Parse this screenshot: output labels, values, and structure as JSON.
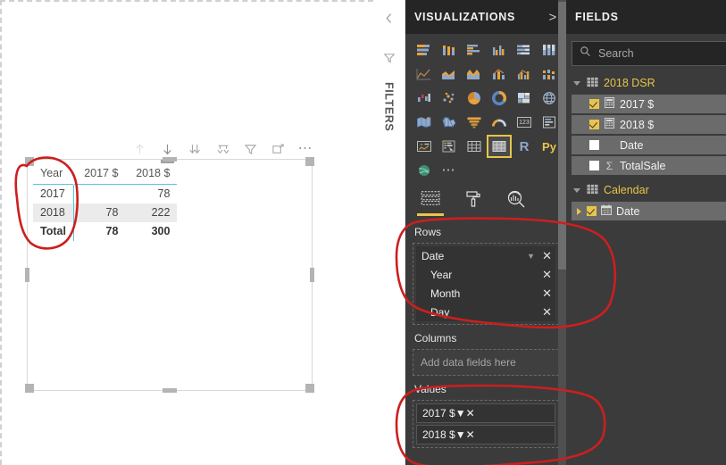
{
  "canvas": {
    "visual_toolbar": [
      {
        "name": "drill-up-icon",
        "label": "Drill Up",
        "state": "disabled"
      },
      {
        "name": "drill-down-icon",
        "label": "Drill Down",
        "state": "active"
      },
      {
        "name": "expand-all-icon",
        "label": "Expand all down one level in the hierarchy",
        "state": "normal"
      },
      {
        "name": "go-to-next-level-icon",
        "label": "Go to the next level in the hierarchy",
        "state": "normal"
      },
      {
        "name": "filter-icon",
        "label": "Filters",
        "state": "normal"
      },
      {
        "name": "focus-mode-icon",
        "label": "Focus mode",
        "state": "normal"
      },
      {
        "name": "more-options-icon",
        "label": "More options",
        "state": "normal"
      }
    ]
  },
  "chart_data": {
    "type": "table",
    "title": "",
    "columns": [
      "Year",
      "2017 $",
      "2018 $"
    ],
    "rows": [
      {
        "label": "2017",
        "values": [
          "",
          "78"
        ],
        "banded": false,
        "total": false
      },
      {
        "label": "2018",
        "values": [
          "78",
          "222"
        ],
        "banded": true,
        "total": false
      },
      {
        "label": "Total",
        "values": [
          "78",
          "300"
        ],
        "banded": false,
        "total": true
      }
    ],
    "categories": [
      "2017",
      "2018",
      "Total"
    ],
    "series": [
      {
        "name": "2017 $",
        "values": [
          null,
          78,
          78
        ]
      },
      {
        "name": "2018 $",
        "values": [
          78,
          222,
          300
        ]
      }
    ],
    "xlabel": "Year",
    "ylabel": "",
    "grid": false,
    "legend": "none",
    "accent_color": "#59c6d6",
    "band_color": "#ebebeb"
  },
  "filters_rail": {
    "collapse_label": "collapse-chevron",
    "filter_icon": "filter-icon",
    "label": "FILTERS"
  },
  "visualizations": {
    "header": "VISUALIZATIONS",
    "header_chevron": ">",
    "selected_visual": "matrix",
    "gallery": [
      {
        "name": "stacked-bar-chart-icon",
        "label": "Stacked bar chart"
      },
      {
        "name": "stacked-column-chart-icon",
        "label": "Stacked column chart"
      },
      {
        "name": "clustered-bar-chart-icon",
        "label": "Clustered bar chart"
      },
      {
        "name": "clustered-column-chart-icon",
        "label": "Clustered column chart"
      },
      {
        "name": "100-stacked-bar-chart-icon",
        "label": "100% Stacked bar chart"
      },
      {
        "name": "100-stacked-column-chart-icon",
        "label": "100% Stacked column chart"
      },
      {
        "name": "line-chart-icon",
        "label": "Line chart"
      },
      {
        "name": "area-chart-icon",
        "label": "Area chart"
      },
      {
        "name": "stacked-area-chart-icon",
        "label": "Stacked area chart"
      },
      {
        "name": "line-stacked-column-chart-icon",
        "label": "Line and stacked column chart"
      },
      {
        "name": "line-clustered-column-chart-icon",
        "label": "Line and clustered column chart"
      },
      {
        "name": "ribbon-chart-icon",
        "label": "Ribbon chart"
      },
      {
        "name": "waterfall-chart-icon",
        "label": "Waterfall chart"
      },
      {
        "name": "scatter-chart-icon",
        "label": "Scatter chart"
      },
      {
        "name": "pie-chart-icon",
        "label": "Pie chart"
      },
      {
        "name": "donut-chart-icon",
        "label": "Donut chart"
      },
      {
        "name": "treemap-icon",
        "label": "Treemap"
      },
      {
        "name": "map-icon",
        "label": "Map"
      },
      {
        "name": "filled-map-icon",
        "label": "Filled map"
      },
      {
        "name": "shape-map-icon",
        "label": "Shape map"
      },
      {
        "name": "funnel-icon",
        "label": "Funnel"
      },
      {
        "name": "gauge-icon",
        "label": "Gauge"
      },
      {
        "name": "card-icon",
        "label": "Card"
      },
      {
        "name": "multi-row-card-icon",
        "label": "Multi-row card"
      },
      {
        "name": "kpi-icon",
        "label": "KPI"
      },
      {
        "name": "slicer-icon",
        "label": "Slicer"
      },
      {
        "name": "table-icon",
        "label": "Table"
      },
      {
        "name": "matrix-icon",
        "label": "Matrix"
      },
      {
        "name": "r-script-visual-icon",
        "label": "R"
      },
      {
        "name": "python-visual-icon",
        "label": "Py"
      },
      {
        "name": "arcgis-maps-icon",
        "label": "ArcGIS Maps for Power BI"
      },
      {
        "name": "get-more-visuals-icon",
        "label": "..."
      }
    ],
    "tabs": [
      {
        "name": "fields-tab",
        "label": "Fields",
        "icon": "fields-grid-icon",
        "active": true
      },
      {
        "name": "format-tab",
        "label": "Format",
        "icon": "paint-roller-icon",
        "active": false
      },
      {
        "name": "analytics-tab",
        "label": "Analytics",
        "icon": "analytics-magnifier-icon",
        "active": false
      }
    ],
    "wells": {
      "rows": {
        "label": "Rows",
        "items": [
          {
            "name": "Date",
            "sub": false,
            "has_caret": true
          },
          {
            "name": "Year",
            "sub": true,
            "has_caret": false
          },
          {
            "name": "Month",
            "sub": true,
            "has_caret": false
          },
          {
            "name": "Day",
            "sub": true,
            "has_caret": false
          }
        ]
      },
      "columns": {
        "label": "Columns",
        "placeholder": "Add data fields here",
        "items": []
      },
      "values": {
        "label": "Values",
        "items": [
          {
            "name": "2017 $",
            "has_caret": true
          },
          {
            "name": "2018 $",
            "has_caret": true
          }
        ]
      }
    }
  },
  "fields": {
    "header": "FIELDS",
    "header_chevron": ">",
    "search": {
      "value": "",
      "placeholder": "Search",
      "icon": "search-icon"
    },
    "tables": [
      {
        "name": "2018 DSR",
        "expanded": true,
        "items": [
          {
            "label": "2017 $",
            "checked": true,
            "icon": "measure-calculator-icon",
            "expandable": false
          },
          {
            "label": "2018 $",
            "checked": true,
            "icon": "measure-calculator-icon",
            "expandable": false
          },
          {
            "label": "Date",
            "checked": false,
            "icon": "none",
            "expandable": false
          },
          {
            "label": "TotalSale",
            "checked": false,
            "icon": "sigma-icon",
            "expandable": false
          }
        ]
      },
      {
        "name": "Calendar",
        "expanded": true,
        "items": [
          {
            "label": "Date",
            "checked": true,
            "icon": "calendar-icon",
            "expandable": true
          }
        ]
      }
    ]
  },
  "annotations": {
    "color": "#cc1f1f",
    "marks": [
      "table-row-header-circle",
      "rows-well-circle",
      "values-well-circle"
    ]
  }
}
